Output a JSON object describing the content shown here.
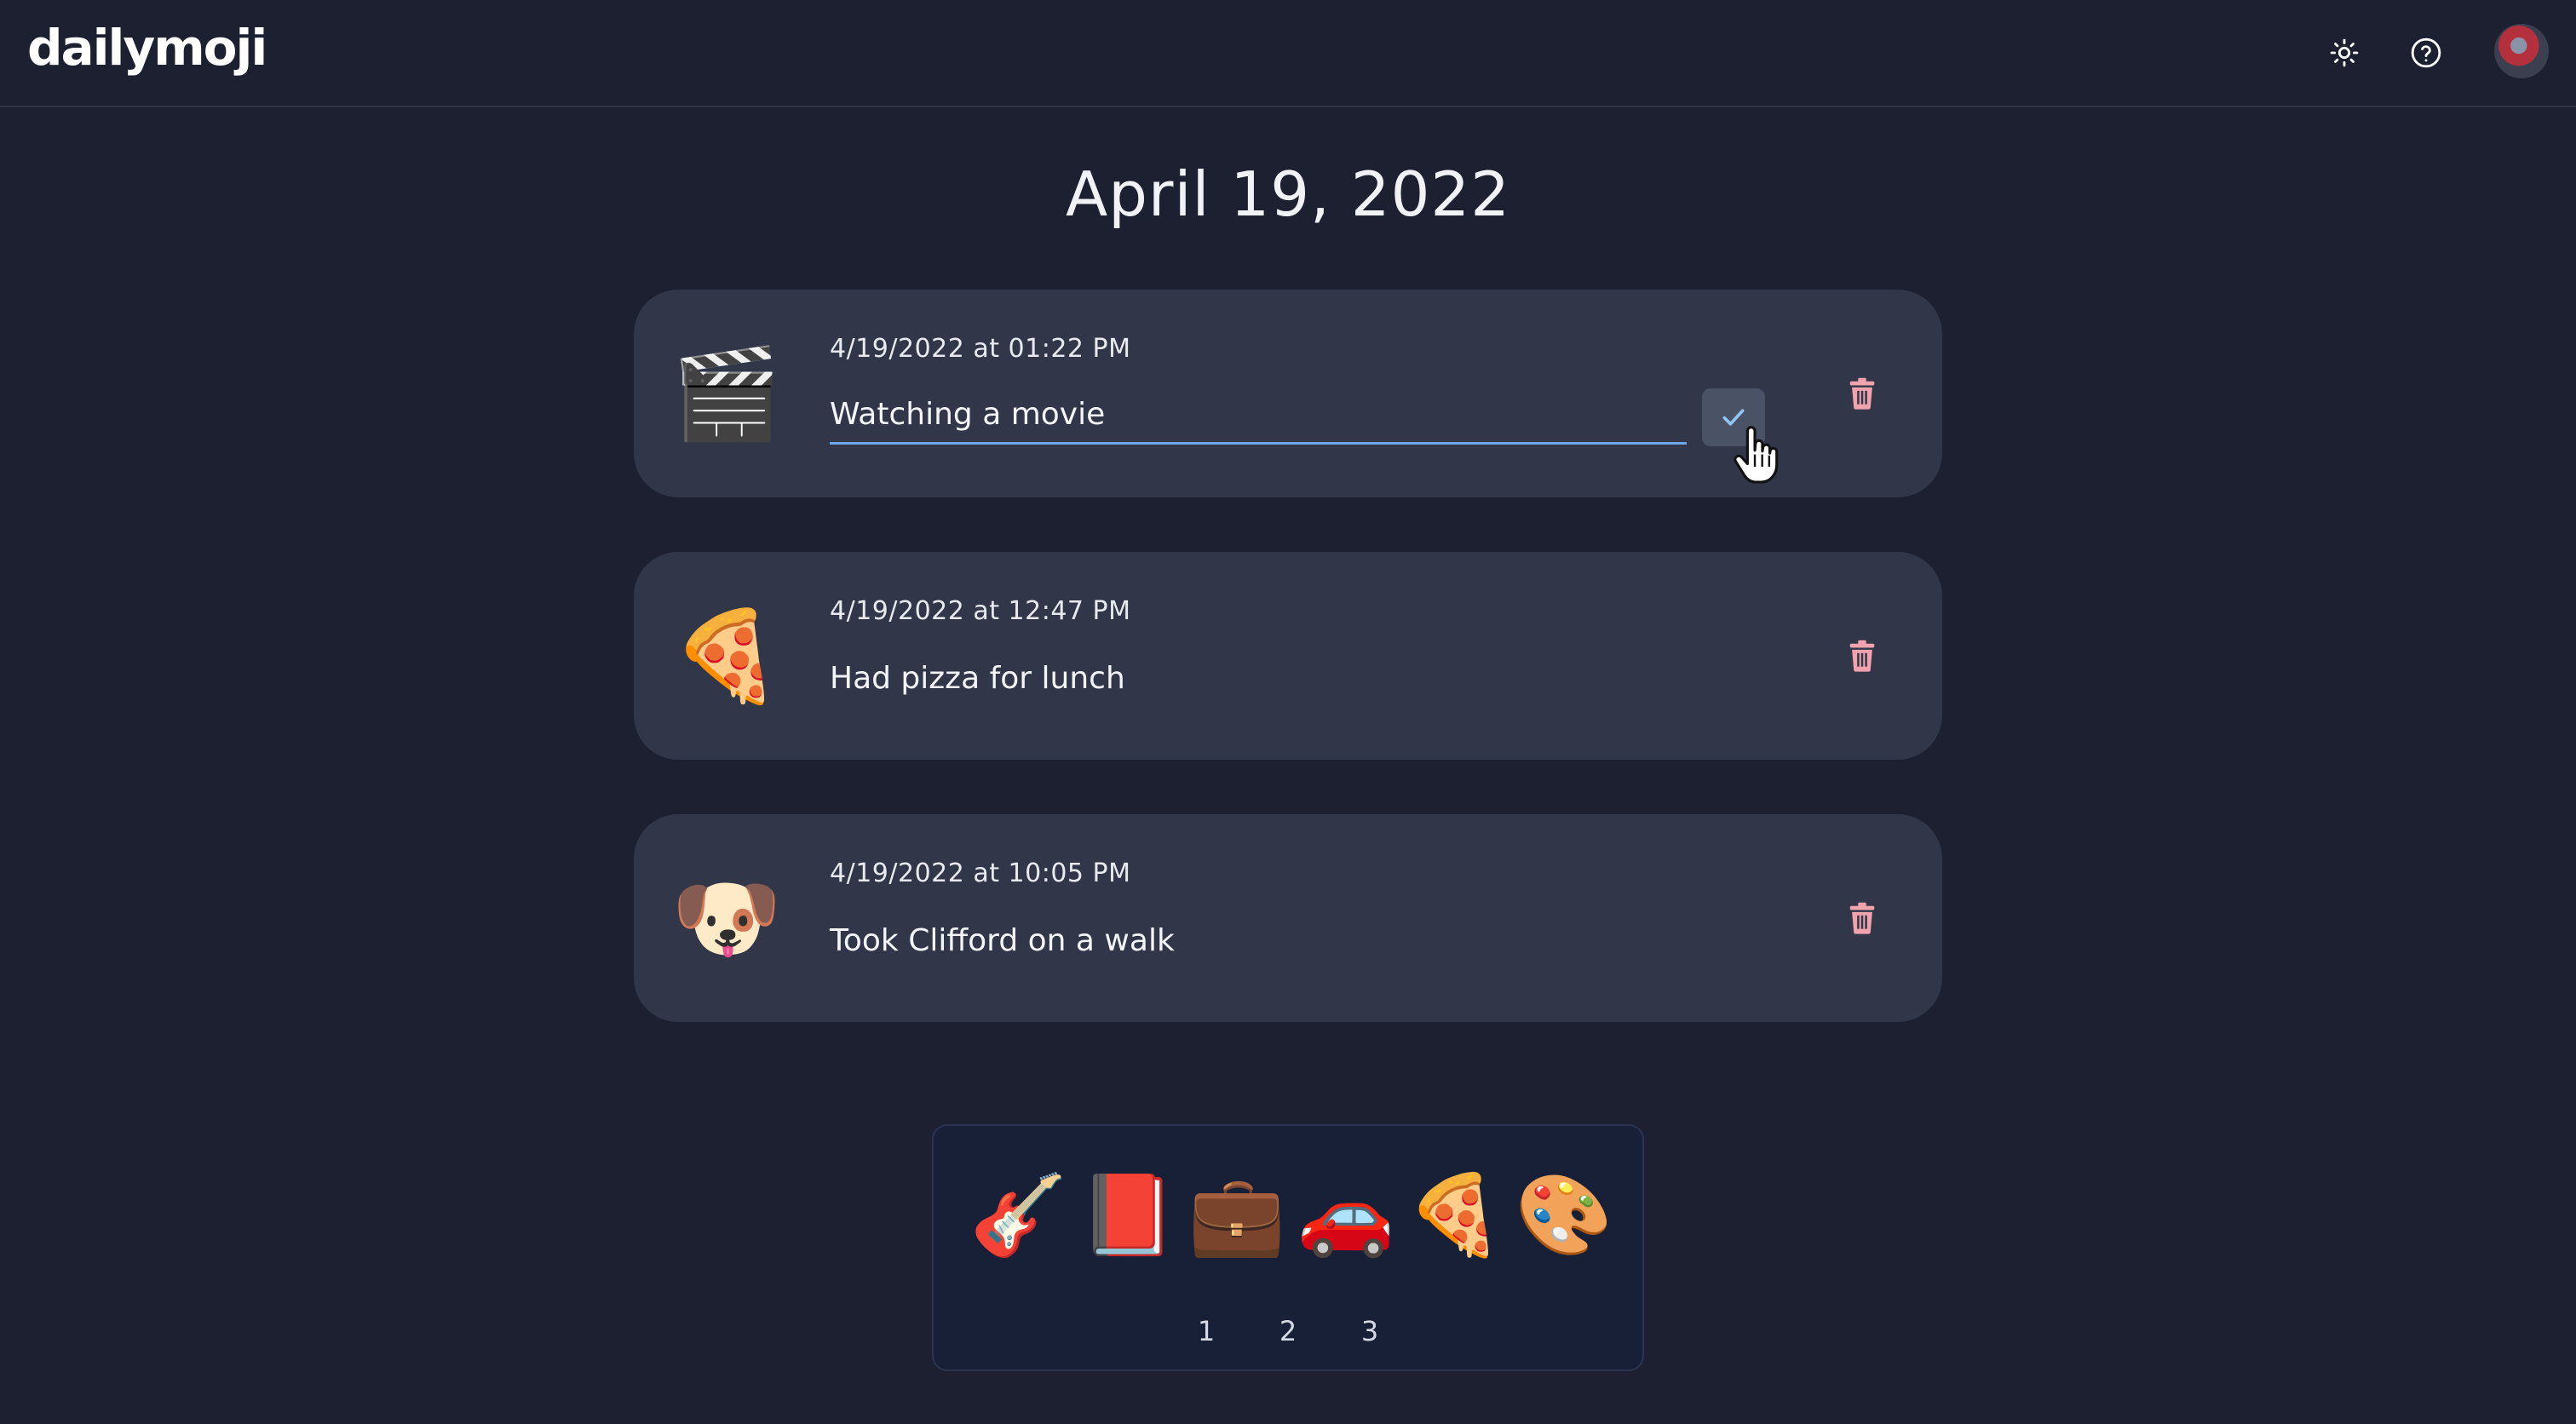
{
  "app": {
    "logo": "dailymoji"
  },
  "header": {
    "icons": [
      "sun-icon",
      "help-icon",
      "avatar"
    ]
  },
  "page": {
    "date_title": "April 19, 2022"
  },
  "entries": [
    {
      "emoji": "🎬",
      "timestamp": "4/19/2022 at 01:22 PM",
      "text": "Watching a movie",
      "editing": true
    },
    {
      "emoji": "🍕",
      "timestamp": "4/19/2022 at 12:47 PM",
      "text": "Had pizza for lunch",
      "editing": false
    },
    {
      "emoji": "🐶",
      "timestamp": "4/19/2022 at 10:05 PM",
      "text": "Took Clifford on a walk",
      "editing": false
    }
  ],
  "picker": {
    "emojis": [
      "🎸",
      "📕",
      "💼",
      "🚗",
      "🍕",
      "🎨"
    ],
    "pages": [
      "1",
      "2",
      "3"
    ]
  },
  "colors": {
    "background": "#1c2030",
    "card": "#313748",
    "input_underline": "#6ea6e8",
    "check_icon": "#8ec5f5",
    "trash_icon": "#f0a3ad",
    "picker_background": "#182038"
  }
}
